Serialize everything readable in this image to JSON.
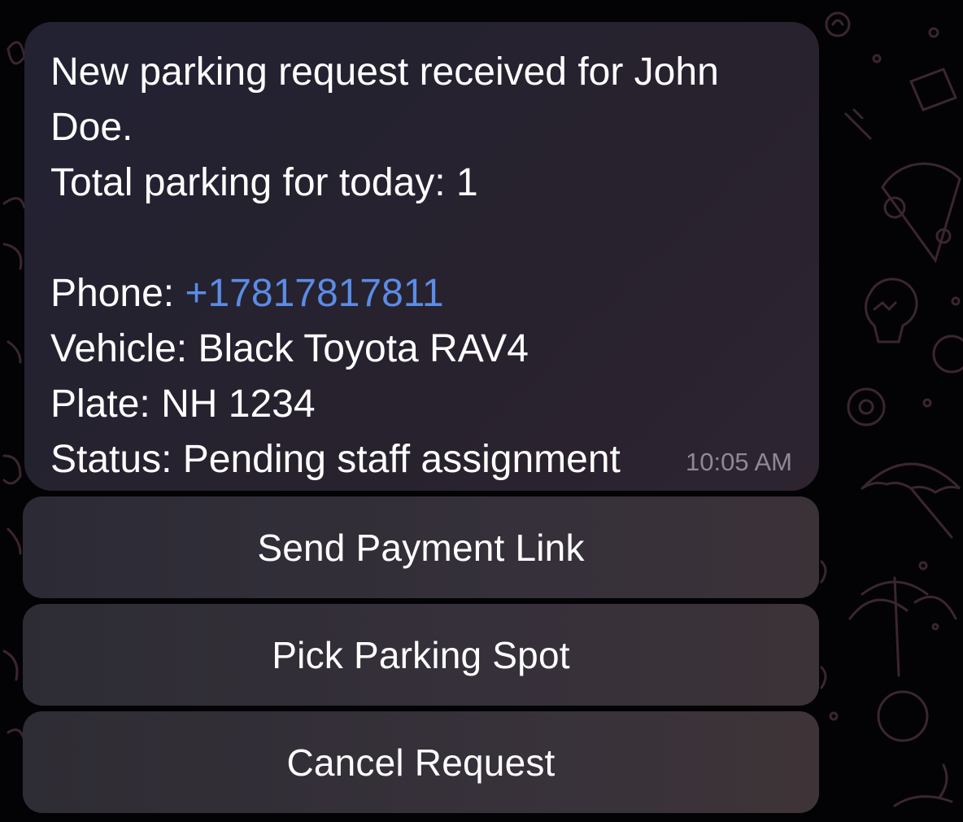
{
  "message": {
    "line1": "New parking request received for John",
    "line2": "Doe.",
    "line3": "Total parking for today: 1",
    "phone_label": "Phone: ",
    "phone_value": "+17817817811",
    "vehicle": "Vehicle: Black Toyota RAV4",
    "plate": "Plate: NH 1234",
    "status": "Status: Pending staff assignment",
    "time": "10:05 AM"
  },
  "buttons": {
    "send_payment": "Send Payment Link",
    "pick_spot": "Pick Parking Spot",
    "cancel": "Cancel Request"
  },
  "colors": {
    "link": "#5b8ce6",
    "bubble": "#262230",
    "button": "#37303a"
  }
}
